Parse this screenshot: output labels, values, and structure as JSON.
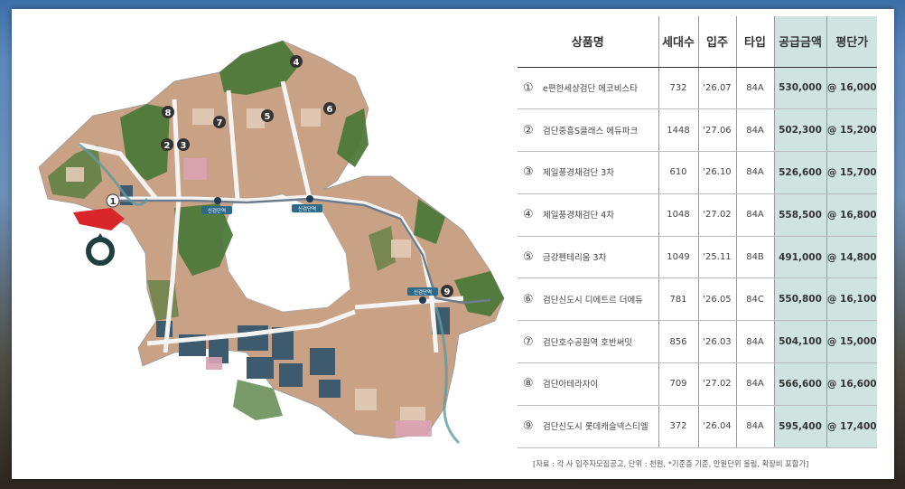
{
  "table": {
    "headers": {
      "name": "상품명",
      "units": "세대수",
      "move_in": "입주",
      "type": "타입",
      "price": "공급금액",
      "per_pyeong": "평단가"
    },
    "rows": [
      {
        "num": "①",
        "name": "e편한세상검단 에코비스타",
        "units": "732",
        "move_in": "'26.07",
        "type": "84A",
        "price": "530,000",
        "per_pyeong": "@ 16,000"
      },
      {
        "num": "②",
        "name": "검단중흥S클래스 에듀파크",
        "units": "1448",
        "move_in": "'27.06",
        "type": "84A",
        "price": "502,300",
        "per_pyeong": "@ 15,200"
      },
      {
        "num": "③",
        "name": "제일풍경채검단 3차",
        "units": "610",
        "move_in": "'26.10",
        "type": "84A",
        "price": "526,600",
        "per_pyeong": "@ 15,700"
      },
      {
        "num": "④",
        "name": "제일풍경채검단 4차",
        "units": "1048",
        "move_in": "'27.02",
        "type": "84A",
        "price": "558,500",
        "per_pyeong": "@ 16,800"
      },
      {
        "num": "⑤",
        "name": "금강펜테리움 3차",
        "units": "1049",
        "move_in": "'25.11",
        "type": "84B",
        "price": "491,000",
        "per_pyeong": "@ 14,800"
      },
      {
        "num": "⑥",
        "name": "검단신도시 디에트르 더에듀",
        "units": "781",
        "move_in": "'26.05",
        "type": "84C",
        "price": "550,800",
        "per_pyeong": "@ 16,100"
      },
      {
        "num": "⑦",
        "name": "검단호수공원역 호반써밋",
        "units": "856",
        "move_in": "'26.03",
        "type": "84A",
        "price": "504,100",
        "per_pyeong": "@ 15,000"
      },
      {
        "num": "⑧",
        "name": "검단아테라자이",
        "units": "709",
        "move_in": "'27.02",
        "type": "84A",
        "price": "566,600",
        "per_pyeong": "@ 16,600"
      },
      {
        "num": "⑨",
        "name": "검단신도시 롯데캐슬넥스티엘",
        "units": "372",
        "move_in": "'26.04",
        "type": "84A",
        "price": "595,400",
        "per_pyeong": "@ 17,400"
      }
    ],
    "footnote": "[자료 : 각 사 입주자모집공고, 단위 : 천원, *기준층 기준, 만원단위 올림, 확장비 포함가]"
  },
  "map": {
    "markers": [
      "1",
      "2",
      "3",
      "4",
      "5",
      "6",
      "7",
      "8",
      "9"
    ],
    "stations": [
      "신검단역",
      "신검단역",
      "신검단역"
    ],
    "colors": {
      "green": "#4e7a3a",
      "brown": "#b5896c",
      "dark_blue": "#3d5a6e",
      "road": "#f2f2f2",
      "highlight": "#d9262b",
      "marker": "#1f4040"
    }
  }
}
